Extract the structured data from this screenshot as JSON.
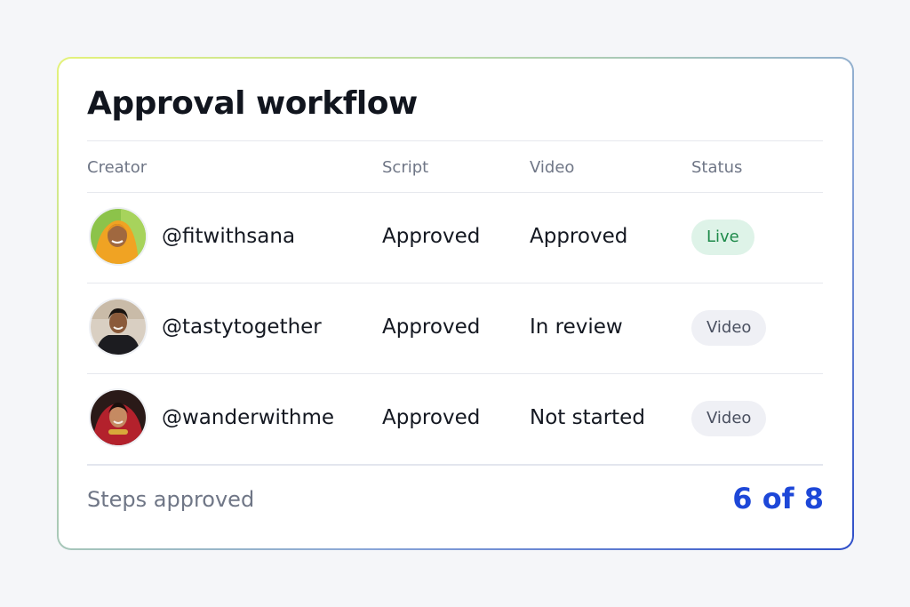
{
  "card": {
    "title": "Approval workflow"
  },
  "table": {
    "headers": {
      "creator": "Creator",
      "script": "Script",
      "video": "Video",
      "status": "Status"
    },
    "rows": [
      {
        "handle": "@fitwithsana",
        "script": "Approved",
        "video": "Approved",
        "status": "Live",
        "status_kind": "success"
      },
      {
        "handle": "@tastytogether",
        "script": "Approved",
        "video": "In review",
        "status": "Video",
        "status_kind": "neutral"
      },
      {
        "handle": "@wanderwithme",
        "script": "Approved",
        "video": "Not started",
        "status": "Video",
        "status_kind": "neutral"
      }
    ]
  },
  "footer": {
    "label": "Steps approved",
    "value": "6 of 8"
  },
  "colors": {
    "accent": "#1d47d8",
    "live_bg": "#def3e8",
    "live_text": "#1e8a4a",
    "neutral_bg": "#eff0f5"
  }
}
